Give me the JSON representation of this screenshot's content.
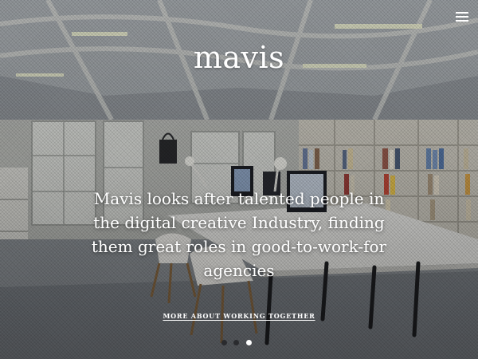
{
  "brand": {
    "name": "mavis"
  },
  "header": {
    "menu_icon": "hamburger-menu-icon"
  },
  "hero": {
    "tagline": "Mavis looks after talented people in the digital creative Industry, finding them great roles in good-to-work-for agencies",
    "cta_label": "MORE ABOUT WORKING TOGETHER",
    "background_image": "office-interior-photo"
  },
  "carousel": {
    "slide_count": 3,
    "active_slide": 3
  },
  "colors": {
    "text": "#ffffff",
    "inactive_dot": "#2a2b2e",
    "active_dot": "#ffffff"
  }
}
